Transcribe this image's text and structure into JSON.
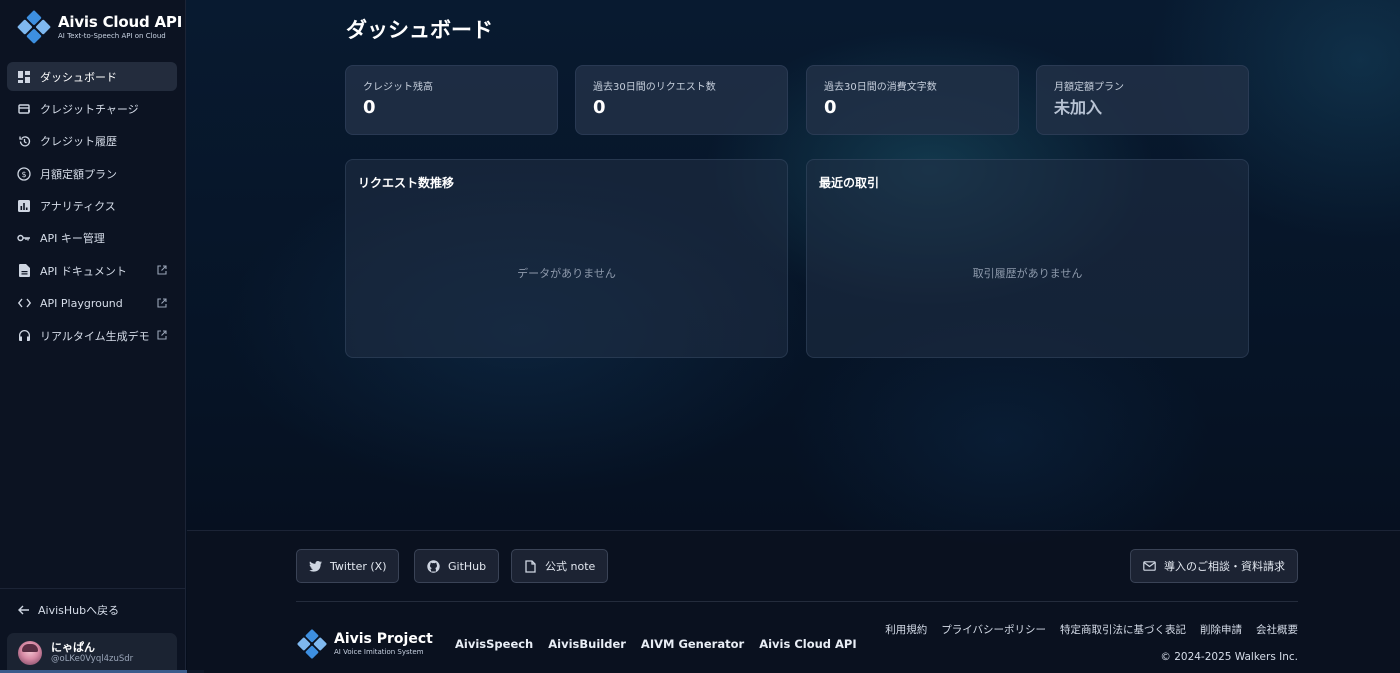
{
  "brand": {
    "title": "Aivis Cloud API",
    "subtitle": "AI Text-to-Speech API on Cloud",
    "accent": "#3d8fe0"
  },
  "sidebar": {
    "items": [
      {
        "label": "ダッシュボード",
        "icon": "dashboard-icon",
        "active": true,
        "external": false
      },
      {
        "label": "クレジットチャージ",
        "icon": "credit-card-icon",
        "active": false,
        "external": false
      },
      {
        "label": "クレジット履歴",
        "icon": "history-icon",
        "active": false,
        "external": false
      },
      {
        "label": "月額定額プラン",
        "icon": "dollar-circle-icon",
        "active": false,
        "external": false
      },
      {
        "label": "アナリティクス",
        "icon": "analytics-icon",
        "active": false,
        "external": false
      },
      {
        "label": "API キー管理",
        "icon": "key-icon",
        "active": false,
        "external": false
      },
      {
        "label": "API ドキュメント",
        "icon": "document-icon",
        "active": false,
        "external": true
      },
      {
        "label": "API Playground",
        "icon": "code-icon",
        "active": false,
        "external": true
      },
      {
        "label": "リアルタイム生成デモ",
        "icon": "headphones-icon",
        "active": false,
        "external": true
      }
    ],
    "back_label": "AivisHubへ戻る",
    "user": {
      "name": "にゃぱん",
      "id": "@oLKe0Vyql4zuSdr"
    }
  },
  "main": {
    "title": "ダッシュボード",
    "stats": [
      {
        "label": "クレジット残高",
        "value": "0"
      },
      {
        "label": "過去30日間のリクエスト数",
        "value": "0"
      },
      {
        "label": "過去30日間の消費文字数",
        "value": "0"
      },
      {
        "label": "月額定額プラン",
        "value": "未加入"
      }
    ],
    "panels": [
      {
        "title": "リクエスト数推移",
        "empty": "データがありません"
      },
      {
        "title": "最近の取引",
        "empty": "取引履歴がありません"
      }
    ]
  },
  "footer": {
    "buttons": [
      {
        "label": "Twitter (X)",
        "icon": "twitter-icon"
      },
      {
        "label": "GitHub",
        "icon": "github-icon"
      },
      {
        "label": "公式 note",
        "icon": "note-icon"
      }
    ],
    "contact_label": "導入のご相談・資料請求",
    "project_title": "Aivis Project",
    "project_subtitle": "AI Voice Imitation System",
    "products": [
      "AivisSpeech",
      "AivisBuilder",
      "AIVM Generator",
      "Aivis Cloud API"
    ],
    "legal": [
      "利用規約",
      "プライバシーポリシー",
      "特定商取引法に基づく表記",
      "削除申請",
      "会社概要"
    ],
    "copyright": "© 2024-2025 Walkers Inc."
  }
}
